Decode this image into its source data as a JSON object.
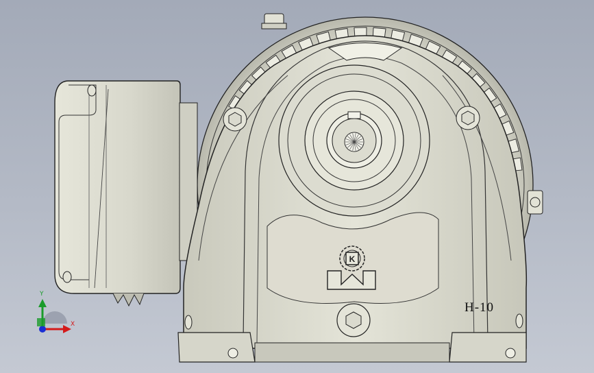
{
  "model": {
    "label": "H-10"
  },
  "triad": {
    "x_label": "X",
    "y_label": "Y",
    "colors": {
      "x": "#d41a1a",
      "y": "#1a9b2a",
      "z": "#1a2fd4"
    }
  },
  "viewport": {
    "background_top": "#a3aab8",
    "background_bottom": "#c4c9d3",
    "part_color": "#d8d8cc"
  }
}
